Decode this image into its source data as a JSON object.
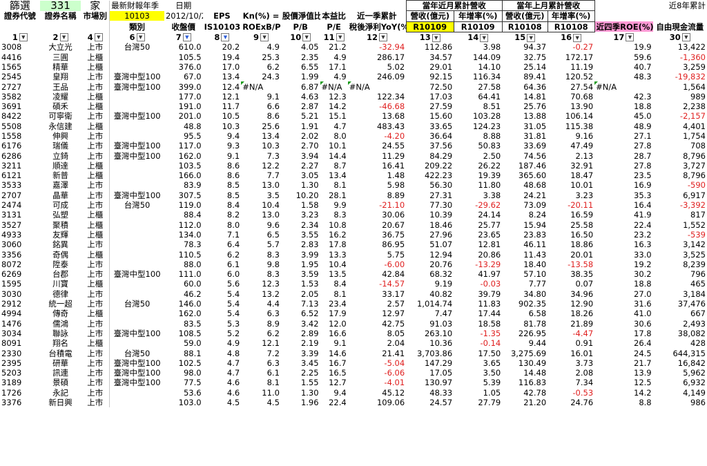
{
  "top": {
    "screen_label": "篩選",
    "count": "331",
    "count_unit": "家",
    "latest_quarter_label": "最新財報年季",
    "latest_quarter": "10103",
    "date_label": "日期",
    "date": "2012/10/29",
    "eps": "EPS",
    "kn": "Kn(%) =",
    "pb_label": "股價淨值比",
    "pe_label": "本益比",
    "recent_q_label": "近一季累計",
    "monthly_rev_label": "當年近月累計營收",
    "prev_rev_label": "當年上月累計營收",
    "fcf8_label": "近8年累計"
  },
  "headers": [
    "證券代號",
    "證券名稱",
    "市場別",
    "類別",
    "收盤價",
    "IS10103",
    "ROExB/P",
    "P/B",
    "P/E",
    "稅後淨利YoY(%)",
    "營收(億元)",
    "年增率(%)",
    "營收(億元)",
    "年增率(%)",
    "近四季ROE(%)",
    "自由現金流量"
  ],
  "subheaders": [
    "",
    "",
    "",
    "",
    "",
    "",
    "",
    "",
    "",
    "",
    "R10109",
    "R10109",
    "R10108",
    "R10108",
    "",
    ""
  ],
  "col_nums": [
    "1",
    "2",
    "4",
    "6",
    "7",
    "8",
    "9",
    "10",
    "11",
    "12",
    "13",
    "14",
    "15",
    "16",
    "17",
    "30"
  ],
  "rows": [
    [
      "3008",
      "大立光",
      "上市",
      "台灣50",
      "610.0",
      "20.2",
      "4.9",
      "4.05",
      "21.2",
      "-32.94",
      "112.86",
      "3.98",
      "94.37",
      "-0.27",
      "19.9",
      "13,422"
    ],
    [
      "4416",
      "三圓",
      "上櫃",
      "",
      "105.5",
      "19.4",
      "25.3",
      "2.35",
      "4.9",
      "286.17",
      "34.57",
      "144.09",
      "32.75",
      "172.17",
      "59.6",
      "-1,360"
    ],
    [
      "1565",
      "精華",
      "上櫃",
      "",
      "376.0",
      "17.0",
      "6.2",
      "6.55",
      "17.1",
      "5.02",
      "29.01",
      "14.10",
      "25.14",
      "11.19",
      "40.7",
      "3,259"
    ],
    [
      "2545",
      "皇翔",
      "上市",
      "臺灣中型100",
      "67.0",
      "13.4",
      "24.3",
      "1.99",
      "4.9",
      "246.09",
      "92.15",
      "116.34",
      "89.41",
      "120.52",
      "48.3",
      "-19,832"
    ],
    [
      "2727",
      "王品",
      "上市",
      "臺灣中型100",
      "399.0",
      "12.4",
      "#N/A",
      "6.87",
      "#N/A",
      "#N/A",
      "72.50",
      "27.58",
      "64.36",
      "27.54",
      "#N/A",
      "1,564"
    ],
    [
      "3582",
      "凌耀",
      "上櫃",
      "",
      "177.0",
      "12.1",
      "9.1",
      "4.63",
      "12.3",
      "122.34",
      "17.03",
      "64.41",
      "14.81",
      "70.68",
      "42.3",
      "989"
    ],
    [
      "3691",
      "碩禾",
      "上櫃",
      "",
      "191.0",
      "11.7",
      "6.6",
      "2.87",
      "14.2",
      "-46.68",
      "27.59",
      "8.51",
      "25.76",
      "13.90",
      "18.8",
      "2,238"
    ],
    [
      "8422",
      "可寧衛",
      "上市",
      "臺灣中型100",
      "201.0",
      "10.5",
      "8.6",
      "5.21",
      "15.1",
      "13.68",
      "15.60",
      "103.28",
      "13.88",
      "106.14",
      "45.0",
      "-2,157"
    ],
    [
      "5508",
      "永信建",
      "上櫃",
      "",
      "48.8",
      "10.3",
      "25.6",
      "1.91",
      "4.7",
      "483.43",
      "33.65",
      "124.23",
      "31.05",
      "115.38",
      "48.9",
      "4,401"
    ],
    [
      "1558",
      "伸興",
      "上市",
      "",
      "95.5",
      "9.4",
      "13.4",
      "2.02",
      "8.0",
      "-4.20",
      "36.64",
      "8.88",
      "31.81",
      "9.16",
      "27.1",
      "1,754"
    ],
    [
      "6176",
      "瑞儀",
      "上市",
      "臺灣中型100",
      "117.0",
      "9.3",
      "10.3",
      "2.70",
      "10.1",
      "24.55",
      "37.56",
      "50.83",
      "33.69",
      "47.49",
      "27.8",
      "708"
    ],
    [
      "6286",
      "立錡",
      "上市",
      "臺灣中型100",
      "162.0",
      "9.1",
      "7.3",
      "3.94",
      "14.4",
      "11.29",
      "84.29",
      "2.50",
      "74.56",
      "2.13",
      "28.7",
      "8,796"
    ],
    [
      "3211",
      "順達",
      "上櫃",
      "",
      "103.5",
      "8.6",
      "12.2",
      "2.27",
      "8.7",
      "16.41",
      "209.22",
      "26.22",
      "187.46",
      "32.91",
      "27.8",
      "3,727"
    ],
    [
      "6121",
      "新普",
      "上櫃",
      "",
      "166.0",
      "8.6",
      "7.7",
      "3.05",
      "13.4",
      "1.48",
      "422.23",
      "19.39",
      "365.60",
      "18.47",
      "23.5",
      "8,796"
    ],
    [
      "3533",
      "嘉澤",
      "上市",
      "",
      "83.9",
      "8.5",
      "13.0",
      "1.30",
      "8.1",
      "5.98",
      "56.30",
      "11.80",
      "48.68",
      "10.01",
      "16.9",
      "-590"
    ],
    [
      "2707",
      "晶華",
      "上市",
      "臺灣中型100",
      "307.5",
      "8.5",
      "3.5",
      "10.20",
      "28.1",
      "8.89",
      "27.31",
      "3.38",
      "24.21",
      "3.23",
      "35.3",
      "6,917"
    ],
    [
      "2474",
      "可成",
      "上市",
      "台灣50",
      "119.0",
      "8.4",
      "10.4",
      "1.58",
      "9.9",
      "-21.10",
      "77.30",
      "-29.62",
      "73.09",
      "-20.11",
      "16.4",
      "-3,392"
    ],
    [
      "3131",
      "弘塑",
      "上櫃",
      "",
      "88.4",
      "8.2",
      "13.0",
      "3.23",
      "8.3",
      "30.06",
      "10.39",
      "24.14",
      "8.24",
      "16.59",
      "41.9",
      "817"
    ],
    [
      "3527",
      "聚積",
      "上櫃",
      "",
      "112.0",
      "8.0",
      "9.6",
      "2.34",
      "10.8",
      "20.67",
      "18.46",
      "25.77",
      "15.94",
      "25.58",
      "22.4",
      "1,552"
    ],
    [
      "4933",
      "友輝",
      "上櫃",
      "",
      "134.0",
      "7.1",
      "6.5",
      "3.55",
      "16.2",
      "36.75",
      "27.96",
      "23.65",
      "23.83",
      "16.50",
      "23.2",
      "-539"
    ],
    [
      "3060",
      "銘異",
      "上市",
      "",
      "78.3",
      "6.4",
      "5.7",
      "2.83",
      "17.8",
      "86.95",
      "51.07",
      "12.81",
      "46.11",
      "18.86",
      "16.3",
      "3,142"
    ],
    [
      "3356",
      "奇偶",
      "上櫃",
      "",
      "110.5",
      "6.2",
      "8.3",
      "3.99",
      "13.3",
      "5.75",
      "12.94",
      "20.86",
      "11.43",
      "20.01",
      "33.0",
      "3,525"
    ],
    [
      "8072",
      "陞泰",
      "上市",
      "",
      "88.0",
      "6.1",
      "9.8",
      "1.95",
      "10.4",
      "-6.00",
      "20.76",
      "-13.29",
      "18.40",
      "-13.58",
      "19.2",
      "8,239"
    ],
    [
      "6269",
      "台郡",
      "上市",
      "臺灣中型100",
      "111.0",
      "6.0",
      "8.3",
      "3.59",
      "13.5",
      "42.84",
      "68.32",
      "41.97",
      "57.10",
      "38.35",
      "30.2",
      "796"
    ],
    [
      "1595",
      "川寶",
      "上櫃",
      "",
      "60.0",
      "5.6",
      "12.3",
      "1.53",
      "8.4",
      "-14.57",
      "9.19",
      "-0.03",
      "7.77",
      "0.07",
      "18.8",
      "465"
    ],
    [
      "3030",
      "德律",
      "上市",
      "",
      "46.2",
      "5.4",
      "13.2",
      "2.05",
      "8.1",
      "33.17",
      "40.82",
      "39.79",
      "34.80",
      "34.96",
      "27.0",
      "3,184"
    ],
    [
      "2912",
      "統一超",
      "上市",
      "台灣50",
      "146.0",
      "5.4",
      "4.4",
      "7.13",
      "23.4",
      "2.57",
      "1,014.74",
      "11.83",
      "902.35",
      "12.90",
      "31.6",
      "37,476"
    ],
    [
      "4994",
      "傳奇",
      "上櫃",
      "",
      "162.0",
      "5.4",
      "6.3",
      "6.52",
      "17.9",
      "12.97",
      "7.47",
      "17.44",
      "6.58",
      "18.26",
      "41.0",
      "667"
    ],
    [
      "1476",
      "儒鴻",
      "上市",
      "",
      "83.5",
      "5.3",
      "8.9",
      "3.42",
      "12.0",
      "42.75",
      "91.03",
      "18.58",
      "81.78",
      "21.89",
      "30.6",
      "2,493"
    ],
    [
      "3034",
      "聯詠",
      "上市",
      "臺灣中型100",
      "108.5",
      "5.2",
      "6.2",
      "2.89",
      "16.6",
      "8.05",
      "263.10",
      "-1.35",
      "226.95",
      "-4.47",
      "17.8",
      "38,082"
    ],
    [
      "8091",
      "翔名",
      "上櫃",
      "",
      "59.0",
      "4.9",
      "12.1",
      "2.19",
      "9.1",
      "2.04",
      "10.36",
      "-0.14",
      "9.44",
      "0.91",
      "26.4",
      "428"
    ],
    [
      "2330",
      "台積電",
      "上市",
      "台灣50",
      "88.1",
      "4.8",
      "7.2",
      "3.39",
      "14.6",
      "21.41",
      "3,703.86",
      "17.50",
      "3,275.69",
      "16.01",
      "24.5",
      "644,315"
    ],
    [
      "2395",
      "研華",
      "上市",
      "臺灣中型100",
      "102.5",
      "4.7",
      "6.3",
      "3.45",
      "16.7",
      "-5.04",
      "147.29",
      "3.65",
      "130.49",
      "3.73",
      "21.7",
      "16,842"
    ],
    [
      "5203",
      "訊連",
      "上市",
      "臺灣中型100",
      "98.0",
      "4.7",
      "6.1",
      "2.25",
      "16.5",
      "-6.06",
      "17.05",
      "3.50",
      "14.48",
      "2.08",
      "13.9",
      "5,962"
    ],
    [
      "3189",
      "景碩",
      "上市",
      "臺灣中型100",
      "77.5",
      "4.6",
      "8.1",
      "1.55",
      "12.7",
      "-4.01",
      "130.97",
      "5.39",
      "116.83",
      "7.34",
      "12.5",
      "6,932"
    ],
    [
      "1726",
      "永記",
      "上市",
      "",
      "53.6",
      "4.6",
      "11.0",
      "1.30",
      "9.4",
      "45.12",
      "48.33",
      "1.05",
      "42.78",
      "-0.53",
      "14.2",
      "4,149"
    ],
    [
      "3376",
      "新日興",
      "上市",
      "",
      "103.0",
      "4.5",
      "4.5",
      "1.96",
      "22.4",
      "109.06",
      "24.57",
      "27.79",
      "21.20",
      "24.76",
      "8.8",
      "986"
    ]
  ],
  "colors": {
    "header_green": "#ccffcc",
    "highlight_yellow": "#ffff00",
    "roe_pink": "#ff9ad5",
    "negative_red": "#e02020"
  }
}
